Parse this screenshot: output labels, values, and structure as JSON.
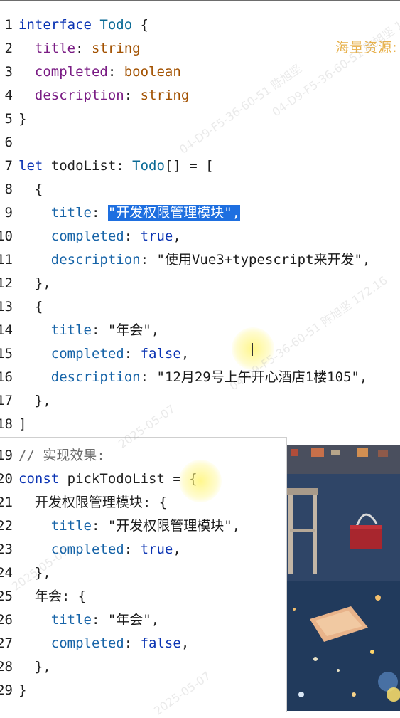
{
  "editor": {
    "lines": [
      {
        "n": "1",
        "parts": [
          [
            "kw",
            "interface "
          ],
          [
            "ty",
            "Todo"
          ],
          [
            "",
            " {"
          ]
        ]
      },
      {
        "n": "2",
        "parts": [
          [
            "",
            "  "
          ],
          [
            "prop",
            "title"
          ],
          [
            "",
            ": "
          ],
          [
            "tval",
            "string"
          ]
        ]
      },
      {
        "n": "3",
        "parts": [
          [
            "",
            "  "
          ],
          [
            "prop",
            "completed"
          ],
          [
            "",
            ": "
          ],
          [
            "tval",
            "boolean"
          ]
        ]
      },
      {
        "n": "4",
        "parts": [
          [
            "",
            "  "
          ],
          [
            "prop",
            "description"
          ],
          [
            "",
            ": "
          ],
          [
            "tval",
            "string"
          ]
        ]
      },
      {
        "n": "5",
        "parts": [
          [
            "",
            "}"
          ]
        ]
      },
      {
        "n": "6",
        "parts": []
      },
      {
        "n": "7",
        "parts": [
          [
            "kw",
            "let "
          ],
          [
            "",
            "todoList: "
          ],
          [
            "ty",
            "Todo"
          ],
          [
            "",
            "[] = ["
          ]
        ]
      },
      {
        "n": "8",
        "parts": [
          [
            "",
            "  {"
          ]
        ]
      },
      {
        "n": "9",
        "parts": [
          [
            "",
            "    "
          ],
          [
            "pkey",
            "title"
          ],
          [
            "",
            ": "
          ],
          [
            "sel",
            "\"开发权限管理模块\","
          ]
        ]
      },
      {
        "n": "10",
        "parts": [
          [
            "",
            "    "
          ],
          [
            "pkey",
            "completed"
          ],
          [
            "",
            ": "
          ],
          [
            "kw",
            "true"
          ],
          [
            "",
            ","
          ]
        ]
      },
      {
        "n": "11",
        "parts": [
          [
            "",
            "    "
          ],
          [
            "pkey",
            "description"
          ],
          [
            "",
            ": "
          ],
          [
            "strb",
            "\"使用Vue3+typescript来开发\""
          ],
          [
            "",
            ","
          ]
        ]
      },
      {
        "n": "12",
        "parts": [
          [
            "",
            "  },"
          ]
        ]
      },
      {
        "n": "13",
        "parts": [
          [
            "",
            "  {"
          ]
        ]
      },
      {
        "n": "14",
        "parts": [
          [
            "",
            "    "
          ],
          [
            "pkey",
            "title"
          ],
          [
            "",
            ": "
          ],
          [
            "strb",
            "\"年会\""
          ],
          [
            "",
            ","
          ]
        ]
      },
      {
        "n": "15",
        "parts": [
          [
            "",
            "    "
          ],
          [
            "pkey",
            "completed"
          ],
          [
            "",
            ": "
          ],
          [
            "kw",
            "false"
          ],
          [
            "",
            ","
          ]
        ]
      },
      {
        "n": "16",
        "parts": [
          [
            "",
            "    "
          ],
          [
            "pkey",
            "description"
          ],
          [
            "",
            ": "
          ],
          [
            "strb",
            "\"12月29号上午开心酒店1楼105\""
          ],
          [
            "",
            ","
          ]
        ]
      },
      {
        "n": "17",
        "parts": [
          [
            "",
            "  },"
          ]
        ]
      },
      {
        "n": "18",
        "parts": [
          [
            "",
            "]"
          ]
        ]
      }
    ],
    "panel_lines": [
      {
        "n": "19",
        "parts": [
          [
            "cmt",
            "// 实现效果:"
          ]
        ]
      },
      {
        "n": "20",
        "parts": [
          [
            "kw",
            "const "
          ],
          [
            "",
            "pickTodoList = "
          ],
          [
            "",
            "{"
          ]
        ]
      },
      {
        "n": "21",
        "parts": [
          [
            "",
            "  开发权限管理模块: {"
          ]
        ]
      },
      {
        "n": "22",
        "parts": [
          [
            "",
            "    "
          ],
          [
            "pkey",
            "title"
          ],
          [
            "",
            ": "
          ],
          [
            "strb",
            "\"开发权限管理模块\""
          ],
          [
            "",
            ","
          ]
        ]
      },
      {
        "n": "23",
        "parts": [
          [
            "",
            "    "
          ],
          [
            "pkey",
            "completed"
          ],
          [
            "",
            ": "
          ],
          [
            "kw",
            "true"
          ],
          [
            "",
            ","
          ]
        ]
      },
      {
        "n": "24",
        "parts": [
          [
            "",
            "  },"
          ]
        ]
      },
      {
        "n": "25",
        "parts": [
          [
            "",
            "  年会: {"
          ]
        ]
      },
      {
        "n": "26",
        "parts": [
          [
            "",
            "    "
          ],
          [
            "pkey",
            "title"
          ],
          [
            "",
            ": "
          ],
          [
            "strb",
            "\"年会\""
          ],
          [
            "",
            ","
          ]
        ]
      },
      {
        "n": "27",
        "parts": [
          [
            "",
            "    "
          ],
          [
            "pkey",
            "completed"
          ],
          [
            "",
            ": "
          ],
          [
            "kw",
            "false"
          ],
          [
            "",
            ","
          ]
        ]
      },
      {
        "n": "28",
        "parts": [
          [
            "",
            "  },"
          ]
        ]
      },
      {
        "n": "29",
        "parts": [
          [
            "",
            "}"
          ]
        ]
      }
    ]
  },
  "overlay": {
    "resource_text": "海量资源: ("
  },
  "watermark": {
    "texts": [
      "04-D9-F5-36-60-51 陈旭坚 172.16",
      "04-D9-F5-36-60-51 陈旭坚",
      "2025-05-07"
    ]
  },
  "colors": {
    "keyword": "#0a33b3",
    "property": "#7a1c84",
    "type_value": "#a25100",
    "selection": "#1e6fe0"
  }
}
